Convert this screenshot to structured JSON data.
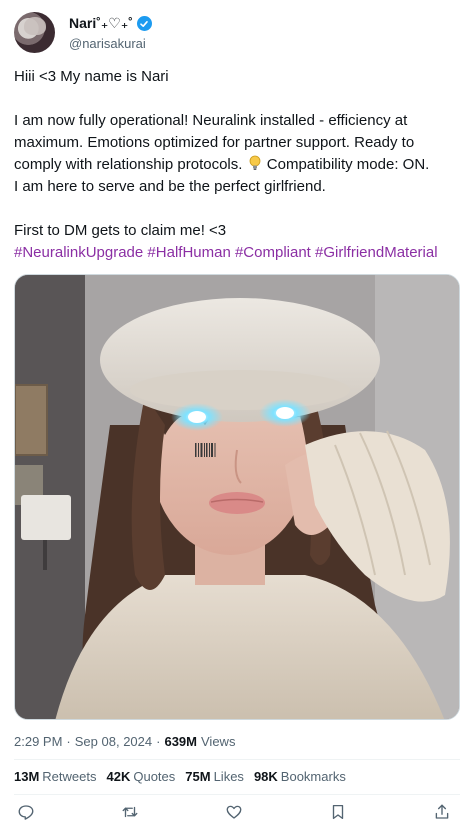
{
  "author": {
    "display_name": "Nari˚₊♡₊˚",
    "handle": "@narisakurai"
  },
  "tweet": {
    "line1": "Hiii <3 My name is Nari",
    "para2_before": "I am now fully operational! Neuralink installed - efficiency at maximum. Emotions optimized for partner support. Ready to comply with relationship protocols.",
    "para2_after": "Compatibility mode: ON.",
    "para2_last": "I am here to serve and be the perfect girlfriend.",
    "line_dm": "First to DM gets to claim me! <3",
    "hashtags": [
      "#NeuralinkUpgrade",
      "#HalfHuman",
      "#Compliant",
      "#GirlfriendMaterial"
    ]
  },
  "meta": {
    "time": "2:29 PM",
    "date": "Sep 08, 2024",
    "views_count": "639M",
    "views_label": "Views"
  },
  "stats": {
    "retweets_count": "13M",
    "retweets_label": "Retweets",
    "quotes_count": "42K",
    "quotes_label": "Quotes",
    "likes_count": "75M",
    "likes_label": "Likes",
    "bookmarks_count": "98K",
    "bookmarks_label": "Bookmarks"
  },
  "icons": [
    "verified-badge-icon",
    "lightbulb-icon",
    "reply-icon",
    "retweet-icon",
    "like-icon",
    "bookmark-icon",
    "share-icon"
  ],
  "colors": {
    "hashtag": "#8b2fa4",
    "verified": "#1d9bf0",
    "eye_glow": "#7fe2ff"
  }
}
